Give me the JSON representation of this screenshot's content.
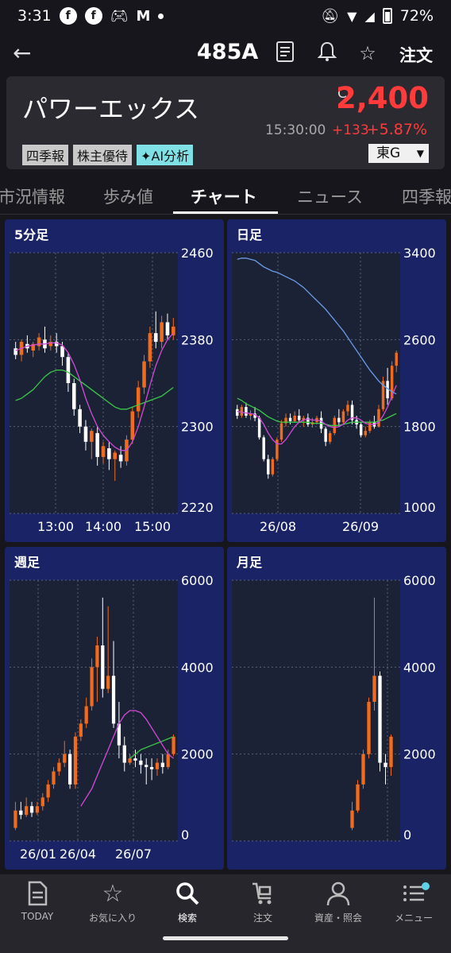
{
  "status": {
    "time": "3:31",
    "battery": "72%"
  },
  "header": {
    "ticker": "485A",
    "order_label": "注文"
  },
  "stock": {
    "name": "パワーエックス",
    "price_flag": "C",
    "price": "2,400",
    "time": "15:30:00",
    "change": "+133",
    "change_pct": "+5.87%",
    "tags": [
      "四季報",
      "株主優待",
      "✦AI分析"
    ],
    "exchange": "東G"
  },
  "tabs": [
    {
      "label": "市況情報"
    },
    {
      "label": "歩み値"
    },
    {
      "label": "チャート"
    },
    {
      "label": "ニュース"
    },
    {
      "label": "四季報"
    }
  ],
  "active_tab": "チャート",
  "colors": {
    "up": "#f26a1b",
    "down": "#ffffff",
    "ma_short": "#d14bd6",
    "ma_mid": "#3cc84a",
    "ma_long": "#6c9be8",
    "price_up": "#ff3b3b",
    "panel": "#1a2366"
  },
  "chart_data": [
    {
      "type": "candlestick",
      "title": "5分足",
      "ylim": [
        2220,
        2460
      ],
      "yticks": [
        "2460",
        "2380",
        "2300",
        "2220"
      ],
      "xticks": [
        "13:00",
        "14:00",
        "15:00"
      ],
      "candles": [
        {
          "o": 2372,
          "h": 2378,
          "c": 2366,
          "l": 2362
        },
        {
          "o": 2366,
          "h": 2380,
          "c": 2378,
          "l": 2360
        },
        {
          "o": 2376,
          "h": 2384,
          "c": 2372,
          "l": 2368
        },
        {
          "o": 2370,
          "h": 2378,
          "c": 2376,
          "l": 2364
        },
        {
          "o": 2374,
          "h": 2386,
          "c": 2382,
          "l": 2370
        },
        {
          "o": 2380,
          "h": 2392,
          "c": 2372,
          "l": 2368
        },
        {
          "o": 2374,
          "h": 2384,
          "c": 2378,
          "l": 2370
        },
        {
          "o": 2378,
          "h": 2386,
          "c": 2374,
          "l": 2368
        },
        {
          "o": 2374,
          "h": 2378,
          "c": 2364,
          "l": 2356
        },
        {
          "o": 2364,
          "h": 2368,
          "c": 2340,
          "l": 2332
        },
        {
          "o": 2340,
          "h": 2344,
          "c": 2316,
          "l": 2310
        },
        {
          "o": 2316,
          "h": 2320,
          "c": 2300,
          "l": 2294
        },
        {
          "o": 2300,
          "h": 2306,
          "c": 2286,
          "l": 2278
        },
        {
          "o": 2286,
          "h": 2298,
          "c": 2296,
          "l": 2270
        },
        {
          "o": 2294,
          "h": 2300,
          "c": 2272,
          "l": 2264
        },
        {
          "o": 2272,
          "h": 2286,
          "c": 2282,
          "l": 2266
        },
        {
          "o": 2280,
          "h": 2286,
          "c": 2270,
          "l": 2260
        },
        {
          "o": 2270,
          "h": 2278,
          "c": 2276,
          "l": 2250
        },
        {
          "o": 2274,
          "h": 2282,
          "c": 2268,
          "l": 2262
        },
        {
          "o": 2268,
          "h": 2292,
          "c": 2288,
          "l": 2264
        },
        {
          "o": 2288,
          "h": 2318,
          "c": 2314,
          "l": 2284
        },
        {
          "o": 2314,
          "h": 2342,
          "c": 2336,
          "l": 2308
        },
        {
          "o": 2336,
          "h": 2366,
          "c": 2360,
          "l": 2330
        },
        {
          "o": 2360,
          "h": 2392,
          "c": 2386,
          "l": 2354
        },
        {
          "o": 2386,
          "h": 2406,
          "c": 2378,
          "l": 2372
        },
        {
          "o": 2378,
          "h": 2402,
          "c": 2396,
          "l": 2372
        },
        {
          "o": 2396,
          "h": 2404,
          "c": 2384,
          "l": 2380
        },
        {
          "o": 2384,
          "h": 2400,
          "c": 2392,
          "l": 2380
        }
      ],
      "ma_short": [
        2370,
        2372,
        2374,
        2375,
        2376,
        2376,
        2377,
        2377,
        2375,
        2368,
        2357,
        2343,
        2326,
        2312,
        2300,
        2292,
        2286,
        2281,
        2278,
        2278,
        2286,
        2300,
        2318,
        2338,
        2356,
        2370,
        2380,
        2386
      ],
      "ma_mid": [
        2324,
        2326,
        2330,
        2334,
        2340,
        2346,
        2350,
        2352,
        2352,
        2350,
        2346,
        2342,
        2338,
        2334,
        2330,
        2326,
        2322,
        2318,
        2316,
        2316,
        2318,
        2320,
        2322,
        2324,
        2326,
        2328,
        2332,
        2336
      ]
    },
    {
      "type": "candlestick",
      "title": "日足",
      "ylim": [
        1000,
        3400
      ],
      "yticks": [
        "3400",
        "2600",
        "1800",
        "1000"
      ],
      "xticks": [
        "26/08",
        "26/09"
      ],
      "candles": [
        {
          "o": 1960,
          "h": 2000,
          "c": 1900,
          "l": 1870
        },
        {
          "o": 1900,
          "h": 2000,
          "c": 1980,
          "l": 1880
        },
        {
          "o": 1980,
          "h": 2020,
          "c": 1900,
          "l": 1880
        },
        {
          "o": 1900,
          "h": 1950,
          "c": 1920,
          "l": 1860
        },
        {
          "o": 1920,
          "h": 1980,
          "c": 1880,
          "l": 1850
        },
        {
          "o": 1880,
          "h": 1900,
          "c": 1700,
          "l": 1680
        },
        {
          "o": 1700,
          "h": 1720,
          "c": 1500,
          "l": 1480
        },
        {
          "o": 1500,
          "h": 1540,
          "c": 1360,
          "l": 1320
        },
        {
          "o": 1360,
          "h": 1520,
          "c": 1500,
          "l": 1340
        },
        {
          "o": 1500,
          "h": 1700,
          "c": 1680,
          "l": 1480
        },
        {
          "o": 1680,
          "h": 1860,
          "c": 1830,
          "l": 1660
        },
        {
          "o": 1830,
          "h": 1920,
          "c": 1880,
          "l": 1800
        },
        {
          "o": 1880,
          "h": 1920,
          "c": 1850,
          "l": 1820
        },
        {
          "o": 1850,
          "h": 1940,
          "c": 1900,
          "l": 1840
        },
        {
          "o": 1900,
          "h": 1960,
          "c": 1860,
          "l": 1840
        },
        {
          "o": 1860,
          "h": 1900,
          "c": 1880,
          "l": 1800
        },
        {
          "o": 1880,
          "h": 1920,
          "c": 1820,
          "l": 1800
        },
        {
          "o": 1820,
          "h": 1880,
          "c": 1840,
          "l": 1790
        },
        {
          "o": 1840,
          "h": 1900,
          "c": 1880,
          "l": 1820
        },
        {
          "o": 1880,
          "h": 1940,
          "c": 1780,
          "l": 1740
        },
        {
          "o": 1780,
          "h": 1800,
          "c": 1660,
          "l": 1620
        },
        {
          "o": 1660,
          "h": 1760,
          "c": 1740,
          "l": 1640
        },
        {
          "o": 1740,
          "h": 1900,
          "c": 1880,
          "l": 1720
        },
        {
          "o": 1880,
          "h": 1960,
          "c": 1840,
          "l": 1800
        },
        {
          "o": 1840,
          "h": 1960,
          "c": 1940,
          "l": 1820
        },
        {
          "o": 1940,
          "h": 2040,
          "c": 2000,
          "l": 1900
        },
        {
          "o": 2000,
          "h": 2040,
          "c": 1860,
          "l": 1820
        },
        {
          "o": 1860,
          "h": 1900,
          "c": 1820,
          "l": 1780
        },
        {
          "o": 1820,
          "h": 1840,
          "c": 1720,
          "l": 1700
        },
        {
          "o": 1720,
          "h": 1800,
          "c": 1760,
          "l": 1700
        },
        {
          "o": 1760,
          "h": 1860,
          "c": 1840,
          "l": 1740
        },
        {
          "o": 1840,
          "h": 1900,
          "c": 1800,
          "l": 1780
        },
        {
          "o": 1800,
          "h": 2000,
          "c": 1960,
          "l": 1790
        },
        {
          "o": 1960,
          "h": 2260,
          "c": 2220,
          "l": 1940
        },
        {
          "o": 2220,
          "h": 2340,
          "c": 2060,
          "l": 2000
        },
        {
          "o": 2060,
          "h": 2400,
          "c": 2360,
          "l": 2040
        },
        {
          "o": 2360,
          "h": 2500,
          "c": 2480,
          "l": 2300
        }
      ],
      "ma_short": [
        1940,
        1930,
        1925,
        1920,
        1910,
        1880,
        1820,
        1740,
        1680,
        1640,
        1640,
        1680,
        1740,
        1800,
        1840,
        1860,
        1870,
        1860,
        1860,
        1850,
        1820,
        1800,
        1790,
        1800,
        1820,
        1860,
        1880,
        1880,
        1860,
        1830,
        1820,
        1820,
        1840,
        1900,
        1980,
        2080,
        2180
      ],
      "ma_mid": [
        2060,
        2040,
        2010,
        1990,
        1970,
        1950,
        1920,
        1890,
        1870,
        1850,
        1840,
        1840,
        1840,
        1840,
        1840,
        1840,
        1840,
        1830,
        1830,
        1830,
        1820,
        1810,
        1810,
        1810,
        1820,
        1830,
        1840,
        1840,
        1840,
        1840,
        1840,
        1840,
        1850,
        1860,
        1880,
        1900,
        1920
      ],
      "ma_long": [
        3340,
        3350,
        3350,
        3340,
        3330,
        3300,
        3270,
        3250,
        3230,
        3220,
        3200,
        3180,
        3160,
        3140,
        3110,
        3080,
        3040,
        3000,
        2960,
        2920,
        2880,
        2830,
        2780,
        2730,
        2680,
        2620,
        2560,
        2500,
        2440,
        2380,
        2320,
        2270,
        2220,
        2180,
        2150,
        2120,
        2100
      ]
    },
    {
      "type": "candlestick",
      "title": "週足",
      "ylim": [
        0,
        6000
      ],
      "yticks": [
        "6000",
        "4000",
        "2000",
        "0"
      ],
      "xticks": [
        "26/01",
        "26/04",
        "26/07"
      ],
      "candles": [
        {
          "o": 300,
          "h": 900,
          "c": 700,
          "l": 250
        },
        {
          "o": 700,
          "h": 900,
          "c": 600,
          "l": 500
        },
        {
          "o": 600,
          "h": 1000,
          "c": 800,
          "l": 550
        },
        {
          "o": 800,
          "h": 900,
          "c": 650,
          "l": 550
        },
        {
          "o": 650,
          "h": 900,
          "c": 800,
          "l": 600
        },
        {
          "o": 800,
          "h": 1100,
          "c": 1000,
          "l": 700
        },
        {
          "o": 1000,
          "h": 1400,
          "c": 1300,
          "l": 900
        },
        {
          "o": 1300,
          "h": 1700,
          "c": 1600,
          "l": 1200
        },
        {
          "o": 1600,
          "h": 1900,
          "c": 1800,
          "l": 1500
        },
        {
          "o": 1800,
          "h": 2300,
          "c": 2000,
          "l": 1700
        },
        {
          "o": 2000,
          "h": 2100,
          "c": 1300,
          "l": 1200
        },
        {
          "o": 1300,
          "h": 2500,
          "c": 2400,
          "l": 1200
        },
        {
          "o": 2400,
          "h": 2800,
          "c": 2700,
          "l": 2300
        },
        {
          "o": 2700,
          "h": 3300,
          "c": 3100,
          "l": 2600
        },
        {
          "o": 3100,
          "h": 4200,
          "c": 4000,
          "l": 3000
        },
        {
          "o": 4000,
          "h": 4700,
          "c": 4500,
          "l": 3200
        },
        {
          "o": 4500,
          "h": 5600,
          "c": 3500,
          "l": 3300
        },
        {
          "o": 3500,
          "h": 5400,
          "c": 3800,
          "l": 3400
        },
        {
          "o": 3800,
          "h": 4600,
          "c": 2700,
          "l": 2600
        },
        {
          "o": 2700,
          "h": 3200,
          "c": 2200,
          "l": 1900
        },
        {
          "o": 2200,
          "h": 2400,
          "c": 1800,
          "l": 1600
        },
        {
          "o": 1800,
          "h": 2000,
          "c": 1900,
          "l": 1750
        },
        {
          "o": 1900,
          "h": 2100,
          "c": 1850,
          "l": 1700
        },
        {
          "o": 1850,
          "h": 2000,
          "c": 1750,
          "l": 1550
        },
        {
          "o": 1750,
          "h": 1900,
          "c": 1700,
          "l": 1300
        },
        {
          "o": 1700,
          "h": 1900,
          "c": 1650,
          "l": 1400
        },
        {
          "o": 1650,
          "h": 1900,
          "c": 1800,
          "l": 1500
        },
        {
          "o": 1800,
          "h": 2000,
          "c": 1700,
          "l": 1550
        },
        {
          "o": 1700,
          "h": 2100,
          "c": 2000,
          "l": 1650
        },
        {
          "o": 2000,
          "h": 2450,
          "c": 2400,
          "l": 1950
        }
      ],
      "ma_short": [
        null,
        null,
        null,
        null,
        null,
        null,
        null,
        null,
        null,
        null,
        null,
        null,
        800,
        1000,
        1200,
        1500,
        1800,
        2100,
        2400,
        2700,
        2900,
        3000,
        3000,
        2950,
        2800,
        2600,
        2400,
        2200,
        2000,
        1900
      ],
      "ma_mid": [
        null,
        null,
        null,
        null,
        null,
        null,
        null,
        null,
        null,
        null,
        null,
        null,
        null,
        null,
        null,
        null,
        null,
        null,
        null,
        null,
        null,
        1900,
        2000,
        2100,
        2150,
        2200,
        2250,
        2300,
        2350,
        2400
      ]
    },
    {
      "type": "candlestick",
      "title": "月足",
      "ylim": [
        0,
        6000
      ],
      "yticks": [
        "6000",
        "4000",
        "2000",
        "0"
      ],
      "xticks": [],
      "candles": [
        {
          "o": 300,
          "h": 900,
          "c": 700,
          "l": 250
        },
        {
          "o": 700,
          "h": 1400,
          "c": 1300,
          "l": 650
        },
        {
          "o": 1300,
          "h": 2100,
          "c": 2000,
          "l": 1200
        },
        {
          "o": 2000,
          "h": 3300,
          "c": 3200,
          "l": 1900
        },
        {
          "o": 3200,
          "h": 5600,
          "c": 3800,
          "l": 3000
        },
        {
          "o": 3800,
          "h": 3900,
          "c": 1800,
          "l": 1600
        },
        {
          "o": 1800,
          "h": 2000,
          "c": 1700,
          "l": 1300
        },
        {
          "o": 1700,
          "h": 2450,
          "c": 2400,
          "l": 1500
        }
      ]
    }
  ],
  "bottom_nav": [
    {
      "label": "TODAY",
      "icon": "document-icon"
    },
    {
      "label": "お気に入り",
      "icon": "star-icon"
    },
    {
      "label": "検索",
      "icon": "search-icon"
    },
    {
      "label": "注文",
      "icon": "cart-icon"
    },
    {
      "label": "資産・照会",
      "icon": "person-icon"
    },
    {
      "label": "メニュー",
      "icon": "menu-icon"
    }
  ]
}
